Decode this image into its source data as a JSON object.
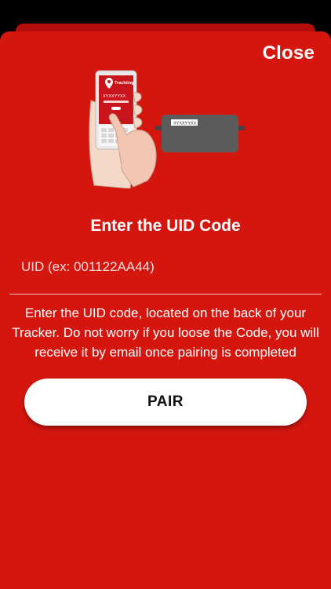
{
  "header": {
    "close_label": "Close"
  },
  "illustration": {
    "phone_brand": "Trackting",
    "phone_code": "XYXXYYXX",
    "device_code": "XYXXYYXX"
  },
  "main": {
    "title": "Enter the UID Code",
    "uid_placeholder": "UID (ex: 001122AA44)",
    "uid_value": "",
    "help_text": "Enter the UID code, located on the back of your Tracker. Do not worry if you loose the Code, you will receive it by email once pairing is completed",
    "pair_label": "PAIR"
  },
  "colors": {
    "sheet_background": "#d4160f",
    "button_background": "#ffffff",
    "text": "#ffffff"
  }
}
